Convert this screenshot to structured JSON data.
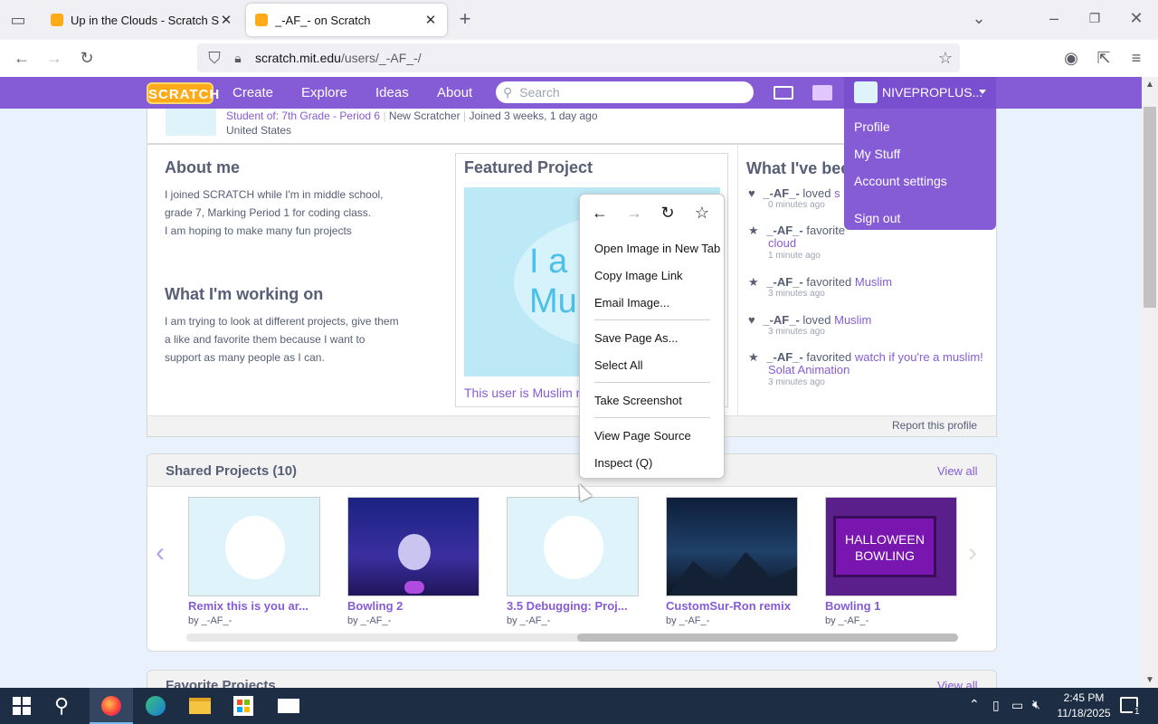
{
  "tabs": [
    {
      "title": "Up in the Clouds - Scratch Studio",
      "close": "✕"
    },
    {
      "title": "_-AF_- on Scratch",
      "close": "✕"
    }
  ],
  "new_tab": "+",
  "url": {
    "domain": "scratch.mit.edu",
    "path": "/users/_-AF_-/"
  },
  "scratch_nav": {
    "logo": "SCRATCH",
    "create": "Create",
    "explore": "Explore",
    "ideas": "Ideas",
    "about": "About",
    "search_placeholder": "Search",
    "username": "NIVEPROPLUS..."
  },
  "profile": {
    "student_of": "Student of: 7th Grade - Period 6",
    "status": "New Scratcher",
    "joined": "Joined 3 weeks, 1 day ago",
    "country": "United States"
  },
  "about": {
    "title": "About me",
    "text": [
      "I joined SCRATCH while I'm in middle school,",
      "grade 7, Marking Period 1 for coding class.",
      "I am hoping to make many fun projects"
    ]
  },
  "working": {
    "title": "What I'm working on",
    "text": [
      "I am trying to look at different projects, give them",
      "a like and favorite them because I want to",
      "support as many people as I can."
    ]
  },
  "featured": {
    "title": "Featured Project",
    "thumb_text": "I a\nMu",
    "caption": "This user is Muslim r"
  },
  "activity": {
    "title": "What I've bee",
    "items": [
      {
        "user": "_-AF_-",
        "verb": "loved",
        "target": "s",
        "time": "0 minutes ago"
      },
      {
        "user": "_-AF_-",
        "verb": "favorite",
        "target": "cloud",
        "time": "1 minute ago"
      },
      {
        "user": "_-AF_-",
        "verb": "favorited",
        "target": "Muslim",
        "time": "3 minutes ago"
      },
      {
        "user": "_-AF_-",
        "verb": "loved",
        "target": "Muslim",
        "time": "3 minutes ago"
      },
      {
        "user": "_-AF_-",
        "verb": "favorited",
        "target": "watch if you're a muslim!",
        "target2": "Solat Animation",
        "time": "3 minutes ago"
      }
    ]
  },
  "report": "Report this profile",
  "shared": {
    "title": "Shared Projects (10)",
    "view_all": "View all",
    "projects": [
      {
        "title": "Remix this is you ar...",
        "by": "by _-AF_-"
      },
      {
        "title": "Bowling 2",
        "by": "by _-AF_-"
      },
      {
        "title": "3.5 Debugging: Proj...",
        "by": "by _-AF_-"
      },
      {
        "title": "CustomSur-Ron remix",
        "by": "by _-AF_-"
      },
      {
        "title": "Bowling 1",
        "by": "by _-AF_-"
      }
    ],
    "halloween_text": "HALLOWEEN BOWLING"
  },
  "favorites": {
    "title": "Favorite Projects",
    "view_all": "View all"
  },
  "dropdown": {
    "profile": "Profile",
    "mystuff": "My Stuff",
    "account": "Account settings",
    "signout": "Sign out"
  },
  "context_menu": {
    "open_image": "Open Image in New Tab",
    "copy_link": "Copy Image Link",
    "email": "Email Image...",
    "save_page": "Save Page As...",
    "select_all": "Select All",
    "screenshot": "Take Screenshot",
    "view_source": "View Page Source",
    "inspect": "Inspect (Q)"
  },
  "taskbar": {
    "time": "2:45 PM",
    "date": "11/18/2025",
    "notif": "1"
  }
}
